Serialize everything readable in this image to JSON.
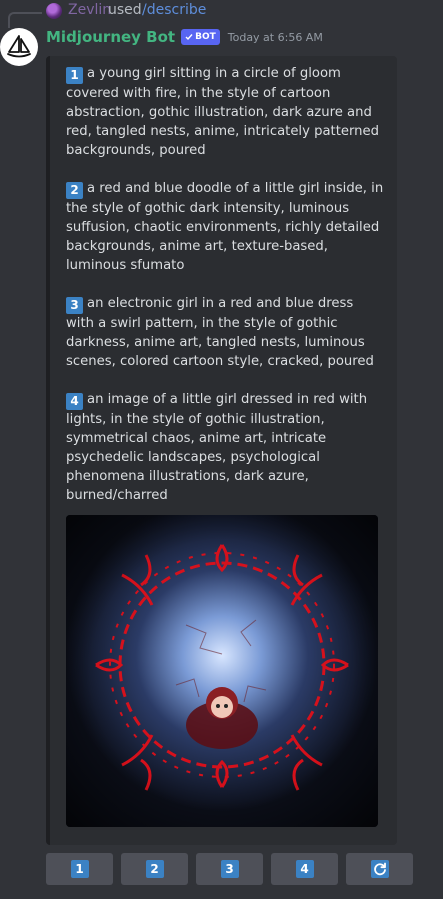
{
  "reply": {
    "username": "Zevlin",
    "used_text": "used",
    "command": "/describe"
  },
  "message": {
    "bot_name": "Midjourney Bot",
    "bot_tag": "BOT",
    "timestamp": "Today at 6:56 AM"
  },
  "descriptions": [
    {
      "num": "1",
      "text": "a young girl sitting in a circle of gloom covered with fire, in the style of cartoon abstraction, gothic illustration, dark azure and red, tangled nests, anime, intricately patterned backgrounds, poured"
    },
    {
      "num": "2",
      "text": "a red and blue doodle of a little girl inside, in the style of gothic dark intensity, luminous suffusion, chaotic environments, richly detailed backgrounds, anime art, texture-based, luminous sfumato"
    },
    {
      "num": "3",
      "text": "an electronic girl in a red and blue dress with a swirl pattern, in the style of gothic darkness, anime art, tangled nests, luminous scenes, colored cartoon style, cracked, poured"
    },
    {
      "num": "4",
      "text": "an image of a little girl dressed in red with lights, in the style of gothic illustration, symmetrical chaos, anime art, intricate psychedelic landscapes, psychological phenomena illustrations, dark azure, burned/charred"
    }
  ],
  "buttons": [
    {
      "label": "1",
      "icon": "number-1"
    },
    {
      "label": "2",
      "icon": "number-2"
    },
    {
      "label": "3",
      "icon": "number-3"
    },
    {
      "label": "4",
      "icon": "number-4"
    },
    {
      "label": "",
      "icon": "refresh-icon"
    }
  ],
  "colors": {
    "background": "#313338",
    "embed_background": "#2b2d31",
    "bot_name": "#43b581",
    "bot_tag": "#5865f2",
    "number_badge": "#3b82c4",
    "button": "#4e5058",
    "command_link": "#5e8edb"
  }
}
